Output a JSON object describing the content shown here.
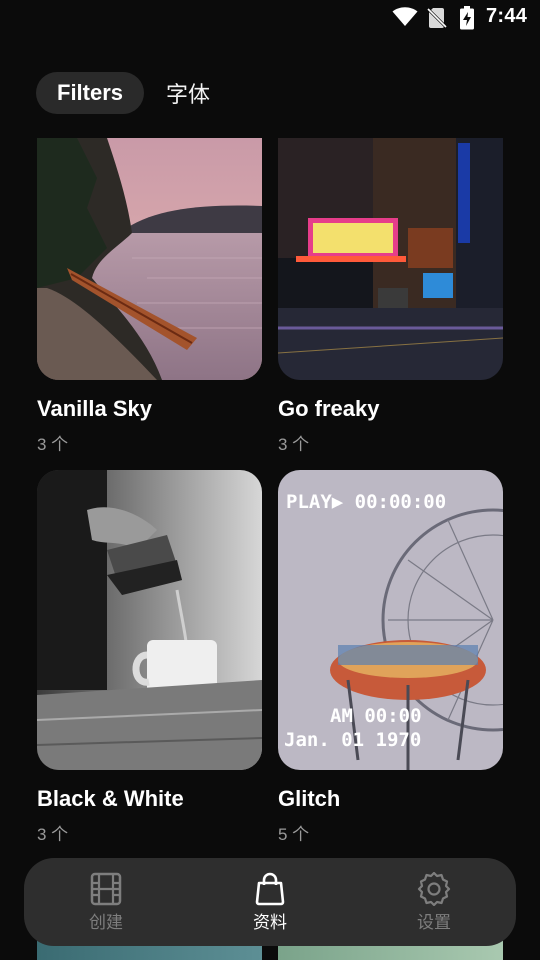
{
  "status_bar": {
    "time": "7:44",
    "icons": [
      "wifi-icon",
      "no-sim-icon",
      "battery-charging-icon"
    ]
  },
  "tabs": [
    {
      "label": "Filters",
      "active": true
    },
    {
      "label": "字体",
      "active": false
    }
  ],
  "filters": [
    {
      "title": "Vanilla Sky",
      "count": "3 个",
      "image": "lake-cliff-sunset-with-canoe"
    },
    {
      "title": "Go freaky",
      "count": "3 个",
      "image": "neon-theater-street-at-night"
    },
    {
      "title": "Black & White",
      "count": "3 个",
      "image": "pouring-coffee-monochrome"
    },
    {
      "title": "Glitch",
      "count": "5 个",
      "image": "ferris-wheel-vhs"
    }
  ],
  "glitch_overlay": {
    "top": "PLAY▶ 00:00:00",
    "line1": "AM 00:00",
    "line2": "Jan. 01 1970"
  },
  "bottom_nav": [
    {
      "label": "创建",
      "icon": "film-icon",
      "active": false
    },
    {
      "label": "资料",
      "icon": "shopping-bag-icon",
      "active": true
    },
    {
      "label": "设置",
      "icon": "gear-icon",
      "active": false
    }
  ],
  "colors": {
    "background": "#0b0b0b",
    "nav_background": "#2e2e2e",
    "active_tab": "#2a2a2a",
    "muted_text": "#9a9a9a"
  }
}
